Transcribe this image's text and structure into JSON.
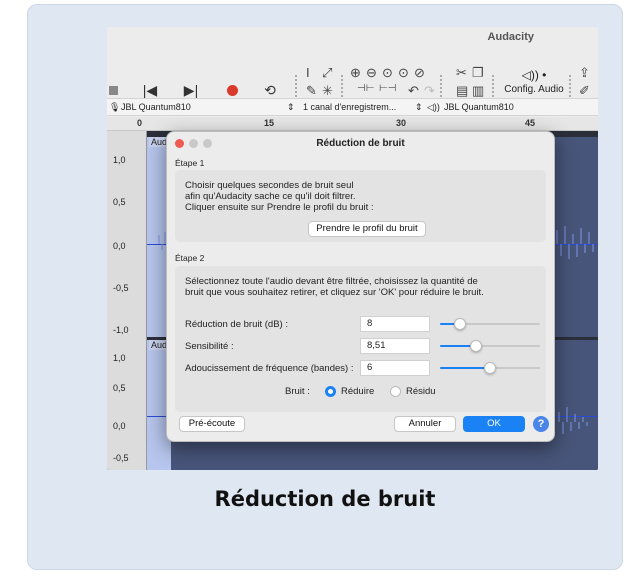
{
  "caption": "Réduction de bruit",
  "app": {
    "title": "Audacity",
    "config_label": "Config. Audio",
    "input_device": "JBL Quantum810",
    "channels": "1 canal d'enregistrem...",
    "output_device": "JBL Quantum810",
    "ruler": [
      "0",
      "15",
      "30",
      "45"
    ],
    "track_label": "Audio",
    "scale_top": [
      "1,0",
      "0,5",
      "0,0",
      "-0,5",
      "-1,0"
    ],
    "scale_bottom": [
      "1,0",
      "0,5",
      "0,0",
      "-0,5"
    ]
  },
  "dialog": {
    "title": "Réduction de bruit",
    "step1": "Étape 1",
    "step1_text": [
      "Choisir quelques secondes de bruit seul",
      "afin qu'Audacity sache ce qu'il doit filtrer.",
      "Cliquer ensuite sur Prendre le profil du bruit :"
    ],
    "profile_button": "Prendre le profil du bruit",
    "step2": "Étape 2",
    "step2_text": [
      "Sélectionnez toute l'audio devant être filtrée, choisissez la quantité de",
      "bruit que vous souhaitez retirer, et cliquez sur 'OK' pour réduire le bruit."
    ],
    "params": [
      {
        "label": "Réduction de bruit (dB) :",
        "value": "8",
        "slider_fraction": 0.2
      },
      {
        "label": "Sensibilité :",
        "value": "8,51",
        "slider_fraction": 0.36
      },
      {
        "label": "Adoucissement de fréquence (bandes) :",
        "value": "6",
        "slider_fraction": 0.5
      }
    ],
    "bruit_label": "Bruit :",
    "option_reduce": "Réduire",
    "option_residue": "Résidu",
    "selected_option": "Réduire",
    "preview_button": "Pré-écoute",
    "cancel_button": "Annuler",
    "ok_button": "OK",
    "help_symbol": "?"
  },
  "colors": {
    "accent": "#1a82f4",
    "record": "#d93a2b",
    "card": "#dfe8f2"
  }
}
